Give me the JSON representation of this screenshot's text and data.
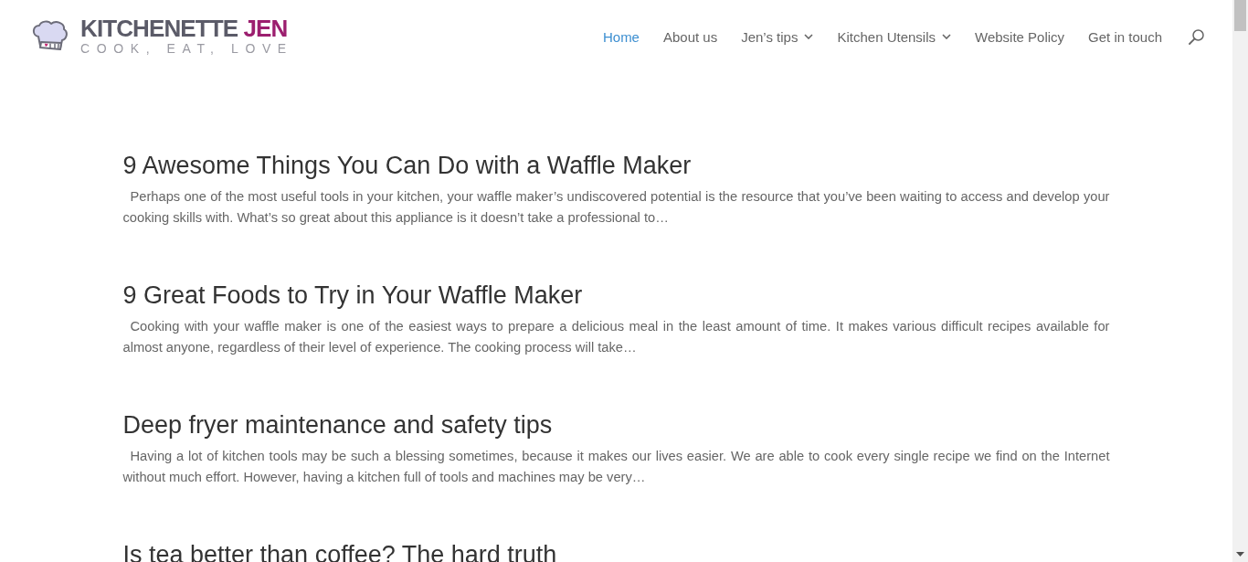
{
  "header": {
    "logo": {
      "name": "KITCHENETTE",
      "accent": "JEN",
      "tagline": "COOK, EAT, LOVE"
    },
    "nav": [
      {
        "label": "Home",
        "selected": true,
        "has_submenu": false
      },
      {
        "label": "About us",
        "selected": false,
        "has_submenu": false
      },
      {
        "label": "Jen’s tips",
        "selected": false,
        "has_submenu": true
      },
      {
        "label": "Kitchen Utensils",
        "selected": false,
        "has_submenu": true
      },
      {
        "label": "Website Policy",
        "selected": false,
        "has_submenu": false
      },
      {
        "label": "Get in touch",
        "selected": false,
        "has_submenu": false
      }
    ]
  },
  "posts": [
    {
      "title": "9 Awesome Things You Can Do with a Waffle Maker",
      "excerpt": "Perhaps one of the most useful tools in your kitchen, your waffle maker’s undiscovered potential is the resource that you’ve been waiting to access and develop your cooking skills with. What’s so great about this appliance is it doesn’t take a professional to…"
    },
    {
      "title": "9 Great Foods to Try in Your Waffle Maker",
      "excerpt": "Cooking with your waffle maker is one of the easiest ways to prepare a delicious meal in the least amount of time. It makes various difficult recipes available for almost anyone, regardless of their level of experience. The cooking process will take…"
    },
    {
      "title": "Deep fryer maintenance and safety tips",
      "excerpt": "Having a lot of kitchen tools may be such a blessing sometimes, because it makes our lives easier. We are able to cook every single recipe we find on the Internet without much effort. However, having a kitchen full of tools and machines may be very…"
    },
    {
      "title": "Is tea better than coffee? The hard truth"
    }
  ]
}
